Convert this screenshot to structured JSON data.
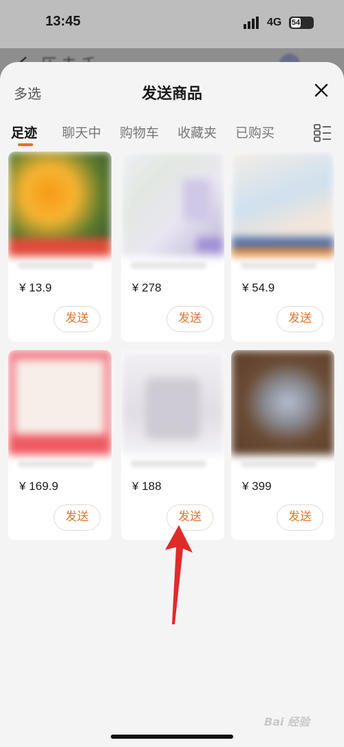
{
  "status_bar": {
    "time": "13:45",
    "network": "4G",
    "battery": "54"
  },
  "background_page": {
    "title": "压 未 千"
  },
  "sheet": {
    "multi_select_label": "多选",
    "title": "发送商品",
    "tabs": [
      {
        "label": "足迹",
        "active": true
      },
      {
        "label": "聊天中",
        "active": false
      },
      {
        "label": "购物车",
        "active": false
      },
      {
        "label": "收藏夹",
        "active": false
      },
      {
        "label": "已购买",
        "active": false
      }
    ]
  },
  "products": [
    {
      "price": "¥ 13.9",
      "send_label": "发送",
      "thumb_colors": [
        "#3a5a2a",
        "#f59a18",
        "#e14a3a"
      ]
    },
    {
      "price": "¥ 278",
      "send_label": "发送",
      "thumb_colors": [
        "#e7e6ee",
        "#b8b2d6",
        "#d8e6d8"
      ]
    },
    {
      "price": "¥ 54.9",
      "send_label": "发送",
      "thumb_colors": [
        "#f1ece6",
        "#a8c4de",
        "#e28a3a"
      ]
    },
    {
      "price": "¥ 169.9",
      "send_label": "发送",
      "thumb_colors": [
        "#f27a86",
        "#f6e9e2",
        "#e7eef3"
      ]
    },
    {
      "price": "¥ 188",
      "send_label": "发送",
      "thumb_colors": [
        "#f0eff2",
        "#dad8e0",
        "#cfcdd6"
      ]
    },
    {
      "price": "¥ 399",
      "send_label": "发送",
      "thumb_colors": [
        "#6a4b34",
        "#b7bfcf",
        "#8c6a4e"
      ]
    }
  ],
  "watermark": "Bai 经验",
  "colors": {
    "accent": "#f26b1d",
    "send_text": "#e0772f",
    "arrow": "#e02a2a"
  }
}
